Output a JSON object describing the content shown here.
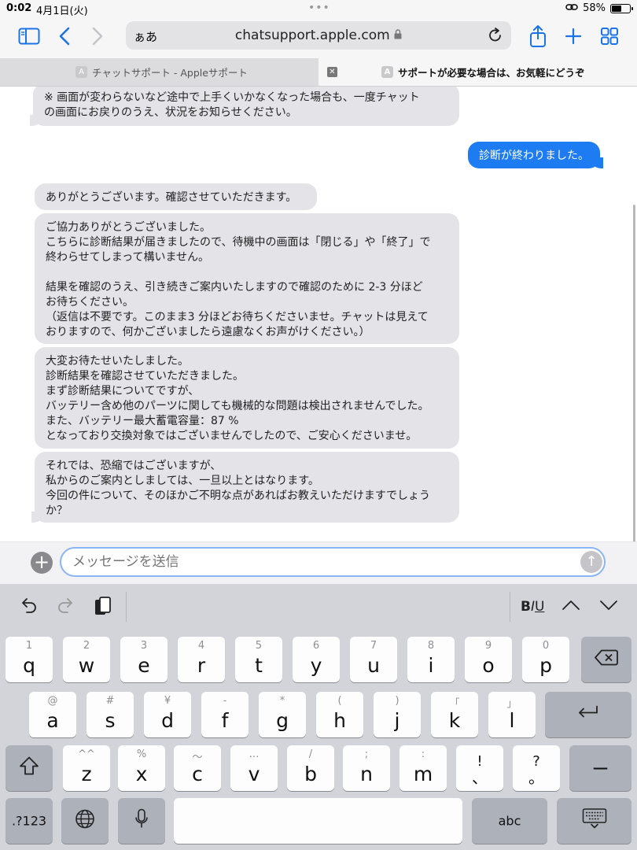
{
  "status": {
    "time": "0:02",
    "date": "4月1日(火)",
    "battery": "58%"
  },
  "toolbar": {
    "aa": "ぁあ",
    "host": "chatsupport.apple.com"
  },
  "tabs": [
    {
      "label": "チャットサポート - Appleサポート",
      "favicon": "A"
    },
    {
      "label": "サポートが必要な場合は、お気軽にどうぞ",
      "favicon": "A"
    }
  ],
  "messages": [
    {
      "from": "agent",
      "text": "※ 画面が変わらないなど途中で上手くいかなくなった場合も、一度チャット\nの画面にお戻りのうえ、状況をお知らせください。"
    },
    {
      "from": "user",
      "text": "診断が終わりました。"
    },
    {
      "from": "agent",
      "text": "ありがとうございます。確認させていただきます。"
    },
    {
      "from": "agent",
      "text": "ご協力ありがとうございました。\nこちらに診断結果が届きましたので、待機中の画面は「閉じる」や「終了」で\n終わらせてしまって構いません。\n\n結果を確認のうえ、引き続きご案内いたしますので確認のために 2-3 分ほど\nお待ちください。\n（返信は不要です。このまま3 分ほどお待ちくださいませ。チャットは見えて\nおりますので、何かございましたら遠慮なくお声がけください。）"
    },
    {
      "from": "agent",
      "text": "大変お待たせいたしました。\n診断結果を確認させていただきました。\nまず診断結果についてですが、\nバッテリー含め他のパーツに関しても機械的な問題は検出されませんでした。\nまた、バッテリー最大蓄電容量：87 %\nとなっており交換対象ではございませんでしたので、ご安心くださいませ。"
    },
    {
      "from": "agent",
      "text": "それでは、恐縮ではございますが、\n私からのご案内としましては、一旦以上とはなります。\n今回の件について、そのほかご不明な点があればお教えいただけますでしょう\nか？"
    }
  ],
  "composer": {
    "placeholder": "メッセージを送信"
  },
  "keyboard": {
    "format": {
      "b": "B",
      "i": "I",
      "u": "U"
    },
    "row1": [
      {
        "k": "q",
        "h": "1"
      },
      {
        "k": "w",
        "h": "2"
      },
      {
        "k": "e",
        "h": "3"
      },
      {
        "k": "r",
        "h": "4"
      },
      {
        "k": "t",
        "h": "5"
      },
      {
        "k": "y",
        "h": "6"
      },
      {
        "k": "u",
        "h": "7"
      },
      {
        "k": "i",
        "h": "8"
      },
      {
        "k": "o",
        "h": "9"
      },
      {
        "k": "p",
        "h": "0"
      }
    ],
    "row2": [
      {
        "k": "a",
        "h": "@"
      },
      {
        "k": "s",
        "h": "#"
      },
      {
        "k": "d",
        "h": "¥"
      },
      {
        "k": "f",
        "h": "-"
      },
      {
        "k": "g",
        "h": "*"
      },
      {
        "k": "h",
        "h": "("
      },
      {
        "k": "j",
        "h": ")"
      },
      {
        "k": "k",
        "h": "「"
      },
      {
        "k": "l",
        "h": "」"
      }
    ],
    "row3": [
      {
        "k": "z",
        "h": "^^"
      },
      {
        "k": "x",
        "h": "%"
      },
      {
        "k": "c",
        "h": "〜"
      },
      {
        "k": "v",
        "h": "…"
      },
      {
        "k": "b",
        "h": "/"
      },
      {
        "k": "n",
        "h": ";"
      },
      {
        "k": "m",
        "h": ":"
      },
      {
        "k": "、",
        "h": "!"
      },
      {
        "k": "。",
        "h": "?"
      }
    ],
    "num_label": ".?123",
    "abc_label": "abc",
    "dash_label": "ー"
  }
}
